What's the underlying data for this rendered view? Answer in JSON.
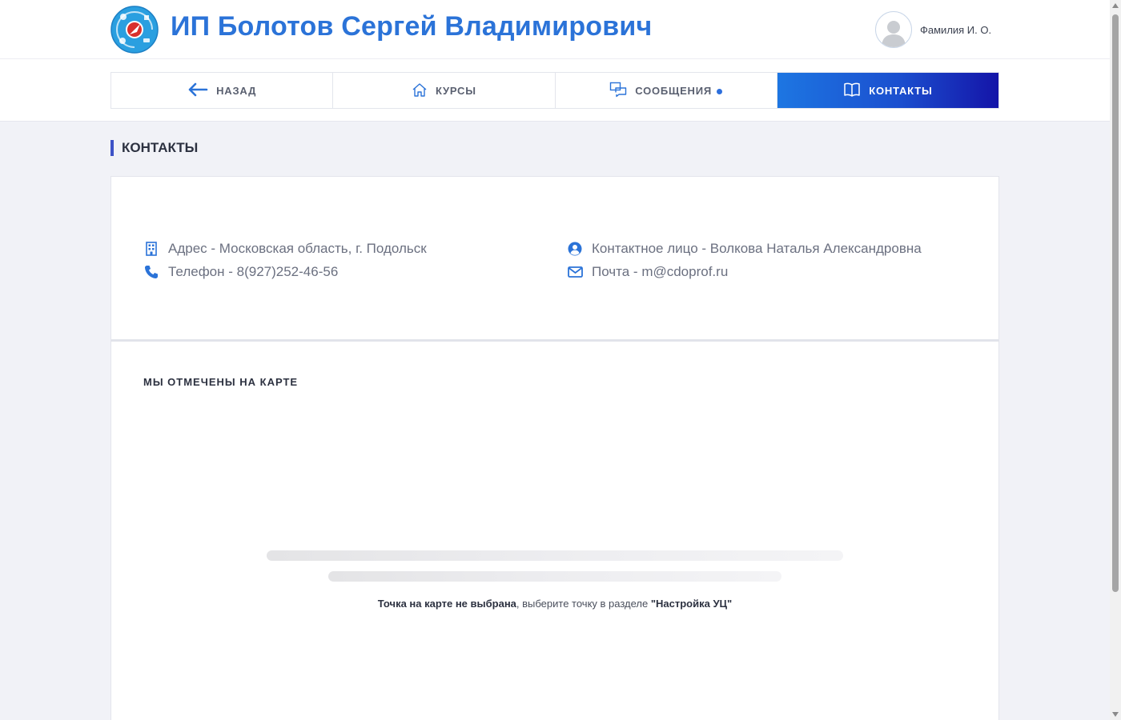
{
  "header": {
    "brand": "ИП Болотов Сергей Владимирович",
    "user_name": "Фамилия И. О."
  },
  "nav": {
    "back": "НАЗАД",
    "courses": "КУРСЫ",
    "messages": "СООБЩЕНИЯ",
    "contacts": "КОНТАКТЫ",
    "active": "contacts"
  },
  "page": {
    "title": "КОНТАКТЫ"
  },
  "contacts": {
    "address": "Адрес - Московская область, г. Подольск",
    "phone": "Телефон - 8(927)252-46-56",
    "contact_person": "Контактное лицо - Волкова Наталья Александровна",
    "email": "Почта - m@cdoprof.ru"
  },
  "map": {
    "title": "МЫ ОТМЕЧЕНЫ НА КАРТЕ",
    "note_bold1": "Точка на карте не выбрана",
    "note_text": ", выберите точку в разделе ",
    "note_bold2": "\"Настройка УЦ\""
  },
  "colors": {
    "accent": "#2b73d8",
    "nav_active_start": "#1d76e2",
    "nav_active_end": "#1414a8",
    "title_bar": "#3d52c7"
  }
}
